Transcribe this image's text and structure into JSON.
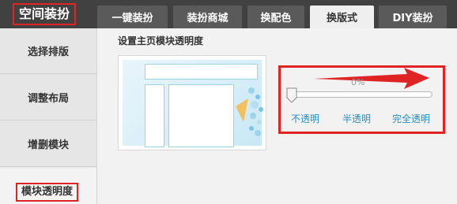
{
  "brand": {
    "title": "空间装扮"
  },
  "tabs": [
    {
      "label": "一键装扮"
    },
    {
      "label": "装扮商城"
    },
    {
      "label": "换配色"
    },
    {
      "label": "换版式",
      "active": true
    },
    {
      "label": "DIY装扮"
    }
  ],
  "sidebar": {
    "items": [
      {
        "label": "选择排版"
      },
      {
        "label": "调整布局"
      },
      {
        "label": "增删模块"
      },
      {
        "label": "模块透明度",
        "active": true
      }
    ]
  },
  "main": {
    "section_title": "设置主页模块透明度",
    "opacity": {
      "value_text": "0%",
      "value": 0,
      "options": [
        "不透明",
        "半透明",
        "完全透明"
      ]
    }
  },
  "colors": {
    "highlight_red": "#e02424",
    "link_blue": "#2a8fc4",
    "topbar": "#414141"
  }
}
